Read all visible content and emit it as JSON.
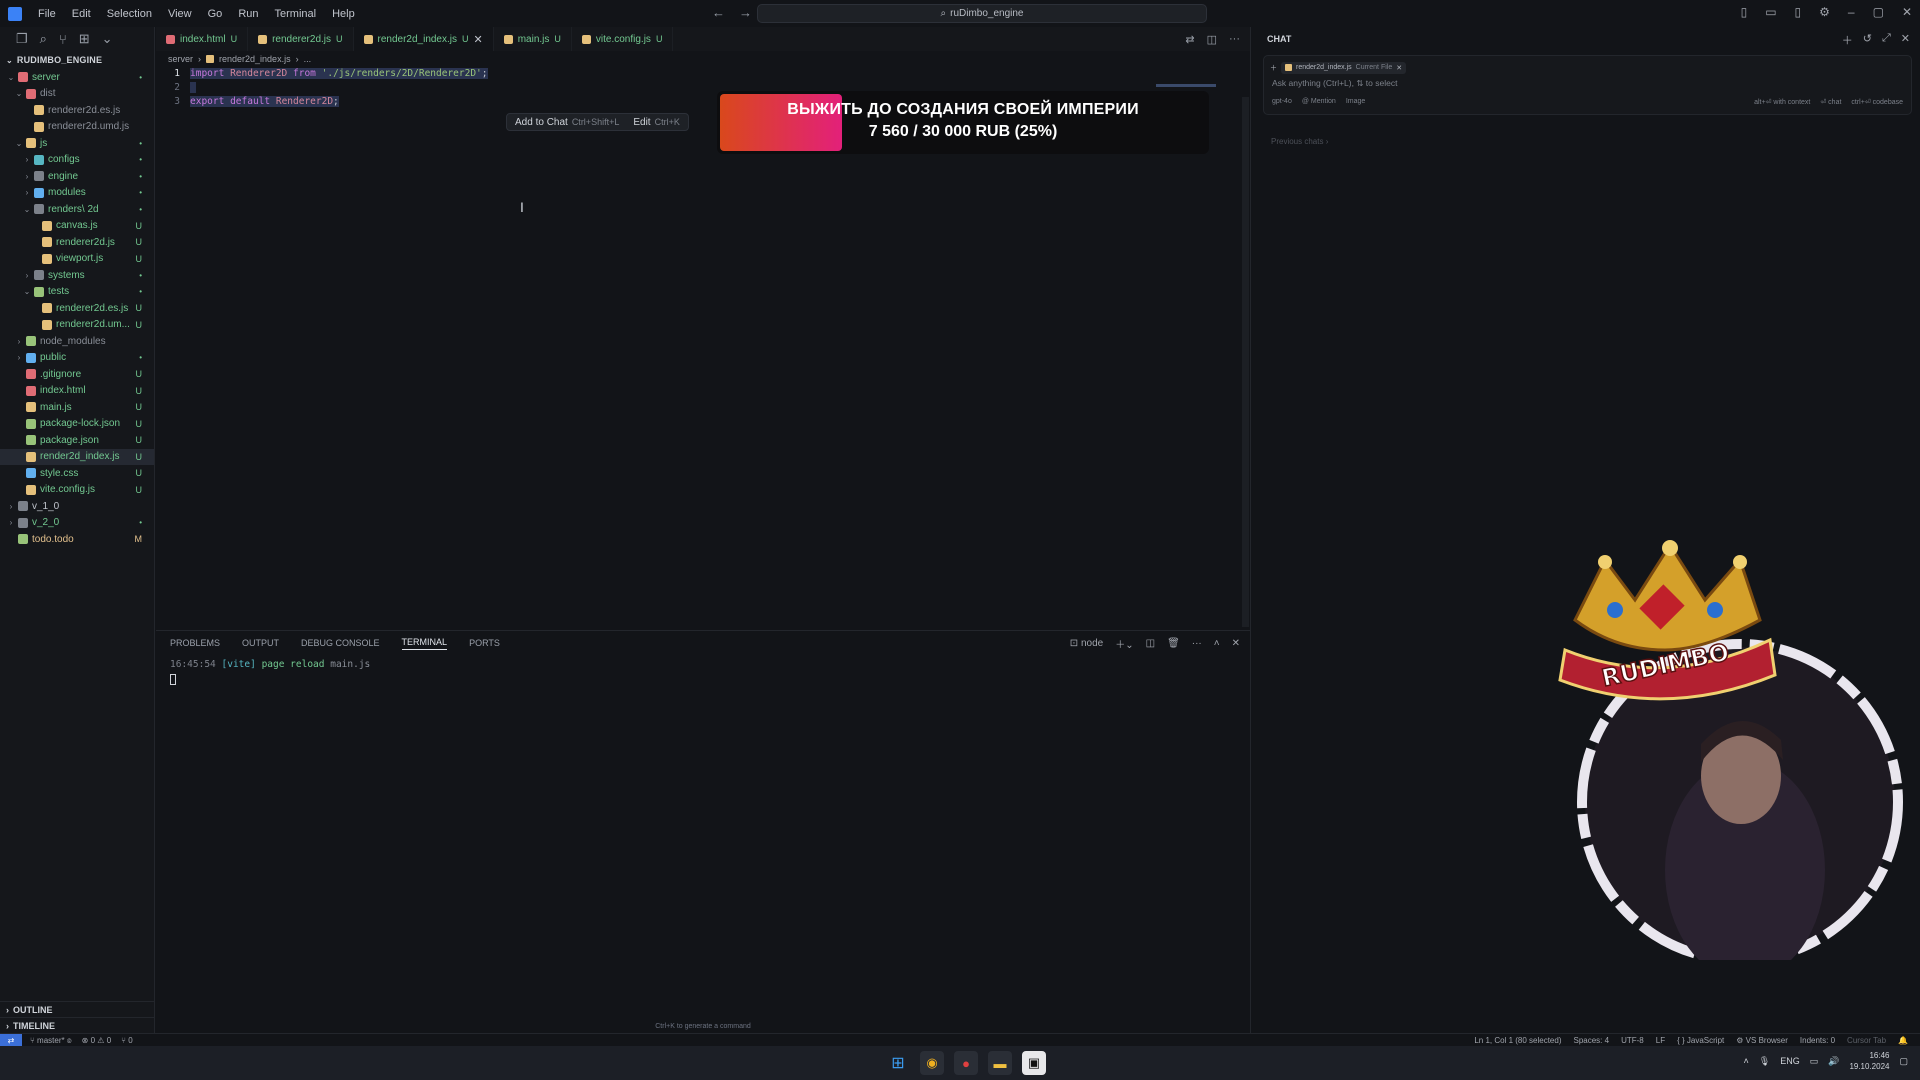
{
  "menu": [
    "File",
    "Edit",
    "Selection",
    "View",
    "Go",
    "Run",
    "Terminal",
    "Help"
  ],
  "search": {
    "text": "ruDimbo_engine"
  },
  "explorer": {
    "root": "RUDIMBO_ENGINE",
    "items": [
      {
        "name": "server",
        "depth": 1,
        "type": "folder",
        "open": true,
        "color": "#e06c75",
        "badge": "•",
        "badge_kind": "dot",
        "name_kind": "untracked"
      },
      {
        "name": "dist",
        "depth": 2,
        "type": "folder",
        "open": true,
        "color": "#e06c75",
        "badge": "",
        "name_kind": "dim"
      },
      {
        "name": "renderer2d.es.js",
        "depth": 3,
        "type": "file",
        "color": "#e5c07b",
        "badge": "",
        "name_kind": "dim"
      },
      {
        "name": "renderer2d.umd.js",
        "depth": 3,
        "type": "file",
        "color": "#e5c07b",
        "badge": "",
        "name_kind": "dim"
      },
      {
        "name": "js",
        "depth": 2,
        "type": "folder",
        "open": true,
        "color": "#e5c07b",
        "badge": "•",
        "badge_kind": "dot",
        "name_kind": "untracked"
      },
      {
        "name": "configs",
        "depth": 3,
        "type": "folder",
        "open": false,
        "color": "#56b6c2",
        "badge": "•",
        "badge_kind": "dot",
        "name_kind": "untracked"
      },
      {
        "name": "engine",
        "depth": 3,
        "type": "folder",
        "open": false,
        "color": "#7c818a",
        "badge": "•",
        "badge_kind": "dot",
        "name_kind": "untracked"
      },
      {
        "name": "modules",
        "depth": 3,
        "type": "folder",
        "open": false,
        "color": "#61afef",
        "badge": "•",
        "badge_kind": "dot",
        "name_kind": "untracked"
      },
      {
        "name": "renders\\ 2d",
        "depth": 3,
        "type": "folder",
        "open": true,
        "color": "#7c818a",
        "badge": "•",
        "badge_kind": "dot",
        "name_kind": "untracked"
      },
      {
        "name": "canvas.js",
        "depth": 4,
        "type": "file",
        "color": "#e5c07b",
        "badge": "U",
        "badge_kind": "u",
        "name_kind": "untracked"
      },
      {
        "name": "renderer2d.js",
        "depth": 4,
        "type": "file",
        "color": "#e5c07b",
        "badge": "U",
        "badge_kind": "u",
        "name_kind": "untracked"
      },
      {
        "name": "viewport.js",
        "depth": 4,
        "type": "file",
        "color": "#e5c07b",
        "badge": "U",
        "badge_kind": "u",
        "name_kind": "untracked"
      },
      {
        "name": "systems",
        "depth": 3,
        "type": "folder",
        "open": false,
        "color": "#7c818a",
        "badge": "•",
        "badge_kind": "dot",
        "name_kind": "untracked"
      },
      {
        "name": "tests",
        "depth": 3,
        "type": "folder",
        "open": true,
        "color": "#98c379",
        "badge": "•",
        "badge_kind": "dot",
        "name_kind": "untracked"
      },
      {
        "name": "renderer2d.es.js",
        "depth": 4,
        "type": "file",
        "color": "#e5c07b",
        "badge": "U",
        "badge_kind": "u",
        "name_kind": "untracked"
      },
      {
        "name": "renderer2d.um...",
        "depth": 4,
        "type": "file",
        "color": "#e5c07b",
        "badge": "U",
        "badge_kind": "u",
        "name_kind": "untracked"
      },
      {
        "name": "node_modules",
        "depth": 2,
        "type": "folder",
        "open": false,
        "color": "#98c379",
        "badge": "",
        "name_kind": "dim"
      },
      {
        "name": "public",
        "depth": 2,
        "type": "folder",
        "open": false,
        "color": "#61afef",
        "badge": "•",
        "badge_kind": "dot",
        "name_kind": "untracked"
      },
      {
        "name": ".gitignore",
        "depth": 2,
        "type": "file",
        "color": "#e06c75",
        "badge": "U",
        "badge_kind": "u",
        "name_kind": "untracked"
      },
      {
        "name": "index.html",
        "depth": 2,
        "type": "file",
        "color": "#e06c75",
        "badge": "U",
        "badge_kind": "u",
        "name_kind": "untracked"
      },
      {
        "name": "main.js",
        "depth": 2,
        "type": "file",
        "color": "#e5c07b",
        "badge": "U",
        "badge_kind": "u",
        "name_kind": "untracked"
      },
      {
        "name": "package-lock.json",
        "depth": 2,
        "type": "file",
        "color": "#98c379",
        "badge": "U",
        "badge_kind": "u",
        "name_kind": "untracked"
      },
      {
        "name": "package.json",
        "depth": 2,
        "type": "file",
        "color": "#98c379",
        "badge": "U",
        "badge_kind": "u",
        "name_kind": "untracked"
      },
      {
        "name": "render2d_index.js",
        "depth": 2,
        "type": "file",
        "color": "#e5c07b",
        "badge": "U",
        "badge_kind": "u",
        "name_kind": "untracked",
        "active": true
      },
      {
        "name": "style.css",
        "depth": 2,
        "type": "file",
        "color": "#61afef",
        "badge": "U",
        "badge_kind": "u",
        "name_kind": "untracked"
      },
      {
        "name": "vite.config.js",
        "depth": 2,
        "type": "file",
        "color": "#e5c07b",
        "badge": "U",
        "badge_kind": "u",
        "name_kind": "untracked"
      },
      {
        "name": "v_1_0",
        "depth": 1,
        "type": "folder",
        "open": false,
        "color": "#7c818a",
        "badge": "",
        "name_kind": "normal"
      },
      {
        "name": "v_2_0",
        "depth": 1,
        "type": "folder",
        "open": false,
        "color": "#7c818a",
        "badge": "•",
        "badge_kind": "dot",
        "name_kind": "untracked"
      },
      {
        "name": "todo.todo",
        "depth": 1,
        "type": "file",
        "color": "#98c379",
        "badge": "M",
        "badge_kind": "m",
        "name_kind": "modified"
      }
    ],
    "outline": "OUTLINE",
    "timeline": "TIMELINE"
  },
  "tabs": [
    {
      "label": "index.html",
      "flag": "U",
      "color": "#e06c75",
      "active": false
    },
    {
      "label": "renderer2d.js",
      "flag": "U",
      "color": "#e5c07b",
      "active": false
    },
    {
      "label": "render2d_index.js",
      "flag": "U",
      "color": "#e5c07b",
      "active": true
    },
    {
      "label": "main.js",
      "flag": "U",
      "color": "#e5c07b",
      "active": false
    },
    {
      "label": "vite.config.js",
      "flag": "U",
      "color": "#e5c07b",
      "active": false
    }
  ],
  "breadcrumb": {
    "folder": "server",
    "file": "render2d_index.js",
    "tail": "..."
  },
  "code": {
    "line1": {
      "num": "1",
      "kw1": "import",
      "id": "Renderer2D",
      "kw2": "from",
      "str": "'./js/renders/2D/Renderer2D'",
      "end": ";"
    },
    "line2": {
      "num": "2"
    },
    "line3": {
      "num": "3",
      "kw1": "export",
      "kw2": "default",
      "id": "Renderer2D",
      "end": ";"
    }
  },
  "inline_actions": {
    "add_label": "Add to Chat",
    "add_kbd": "Ctrl+Shift+L",
    "edit_label": "Edit",
    "edit_kbd": "Ctrl+K"
  },
  "donation": {
    "title": "ВЫЖИТЬ ДО СОЗДАНИЯ СВОЕЙ ИМПЕРИИ",
    "amount": "7 560 / 30 000 RUB (25%)",
    "progress": 0.25
  },
  "panel": {
    "tabs": [
      "PROBLEMS",
      "OUTPUT",
      "DEBUG CONSOLE",
      "TERMINAL",
      "PORTS"
    ],
    "active_tab": "TERMINAL",
    "shell": "node",
    "terminal": {
      "time": "16:45:54",
      "tag": "[vite]",
      "msg": "page reload",
      "file": "main.js"
    },
    "hint": "Ctrl+K to generate a command"
  },
  "chat": {
    "title": "CHAT",
    "context_file": "render2d_index.js",
    "context_label": "Current File",
    "placeholder": "Ask anything (Ctrl+L), ⇅ to select",
    "options_left": [
      "gpt-4o",
      "@ Mention",
      "Image"
    ],
    "options_right": [
      "alt+⏎ with context",
      "⏎ chat",
      "ctrl+⏎ codebase"
    ],
    "previous": "Previous chats ›"
  },
  "webcam": {
    "crown_text": "RUDIMBO"
  },
  "statusbar": {
    "branch": "master*",
    "errors": "0",
    "warnings": "0",
    "ports": "0",
    "position": "Ln 1, Col 1 (80 selected)",
    "spaces": "Spaces: 4",
    "encoding": "UTF-8",
    "eol": "LF",
    "language": "JavaScript",
    "browser": "VS Browser",
    "indents": "Indents: 0",
    "cursor_tab": "Cursor Tab"
  },
  "taskbar": {
    "lang": "ENG",
    "time": "16:46",
    "date": "19.10.2024"
  }
}
